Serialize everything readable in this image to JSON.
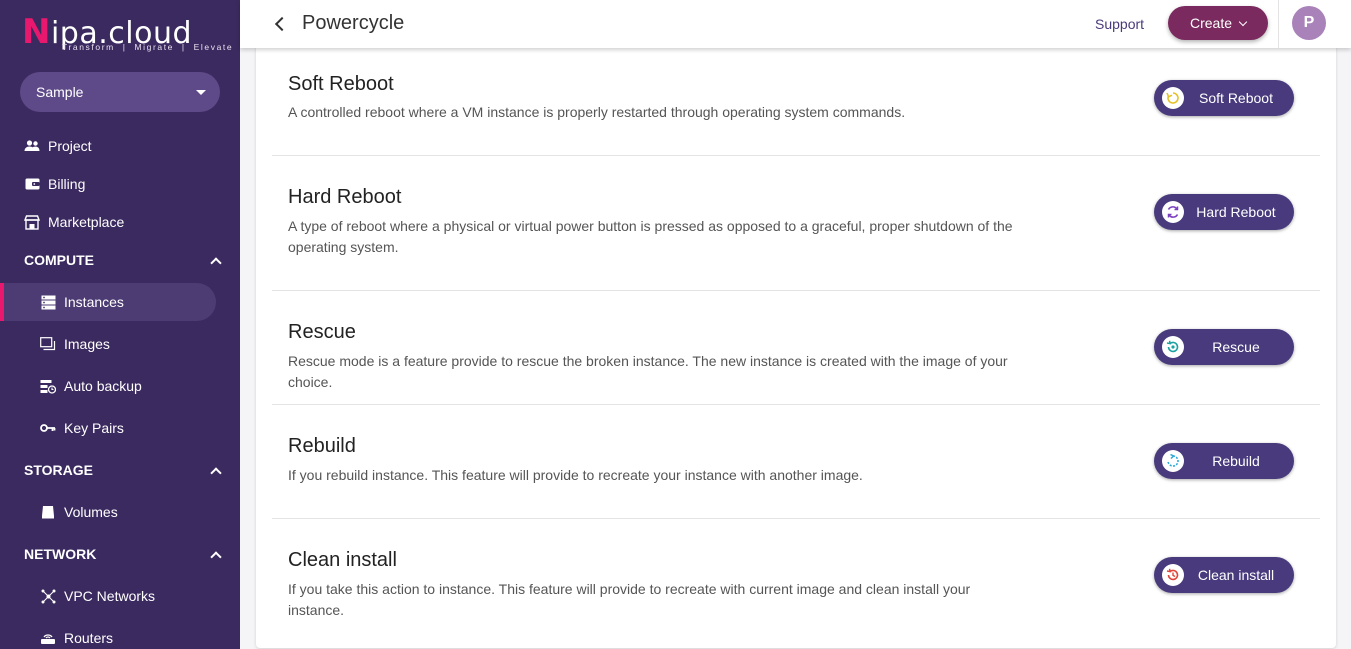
{
  "app": {
    "logo_text": "nipa.cloud",
    "logo_tagline": "Transform | Migrate | Elevate",
    "accent_color": "#e8186f",
    "sidebar_color": "#3b2a5f"
  },
  "sidebar": {
    "project_select": {
      "value": "Sample"
    },
    "top_items": [
      {
        "label": "Project",
        "icon": "people-icon"
      },
      {
        "label": "Billing",
        "icon": "wallet-icon"
      },
      {
        "label": "Marketplace",
        "icon": "store-icon"
      }
    ],
    "sections": [
      {
        "title": "COMPUTE",
        "expanded": true,
        "items": [
          {
            "label": "Instances",
            "icon": "server-icon",
            "active": true
          },
          {
            "label": "Images",
            "icon": "images-icon"
          },
          {
            "label": "Auto backup",
            "icon": "backup-icon"
          },
          {
            "label": "Key Pairs",
            "icon": "key-icon"
          }
        ]
      },
      {
        "title": "STORAGE",
        "expanded": true,
        "items": [
          {
            "label": "Volumes",
            "icon": "disk-icon"
          }
        ]
      },
      {
        "title": "NETWORK",
        "expanded": true,
        "items": [
          {
            "label": "VPC Networks",
            "icon": "network-icon"
          },
          {
            "label": "Routers",
            "icon": "router-icon"
          }
        ]
      }
    ]
  },
  "header": {
    "title": "Powercycle",
    "support_label": "Support",
    "create_label": "Create",
    "avatar_initial": "P"
  },
  "actions": [
    {
      "title": "Soft Reboot",
      "description": "A controlled reboot where a VM instance is properly restarted through operating system commands.",
      "button_label": "Soft Reboot",
      "icon": "soft-reboot-icon",
      "icon_color": "#e6c229"
    },
    {
      "title": "Hard Reboot",
      "description": "A type of reboot where a physical or virtual power button is pressed as opposed to a graceful, proper shutdown of the operating system.",
      "button_label": "Hard Reboot",
      "icon": "hard-reboot-icon",
      "icon_color": "#7a3fc0"
    },
    {
      "title": "Rescue",
      "description": "Rescue mode is a feature provide to rescue the broken instance. The new instance is created with the image of your choice.",
      "button_label": "Rescue",
      "icon": "rescue-icon",
      "icon_color": "#1aa3a0"
    },
    {
      "title": "Rebuild",
      "description": "If you rebuild instance. This feature will provide to recreate your instance with another image.",
      "button_label": "Rebuild",
      "icon": "rebuild-icon",
      "icon_color": "#2aa8d8"
    },
    {
      "title": "Clean install",
      "description": "If you take this action to instance. This feature will provide to recreate with current image and clean install your instance.",
      "button_label": "Clean install",
      "icon": "clean-install-icon",
      "icon_color": "#e0443a"
    }
  ]
}
